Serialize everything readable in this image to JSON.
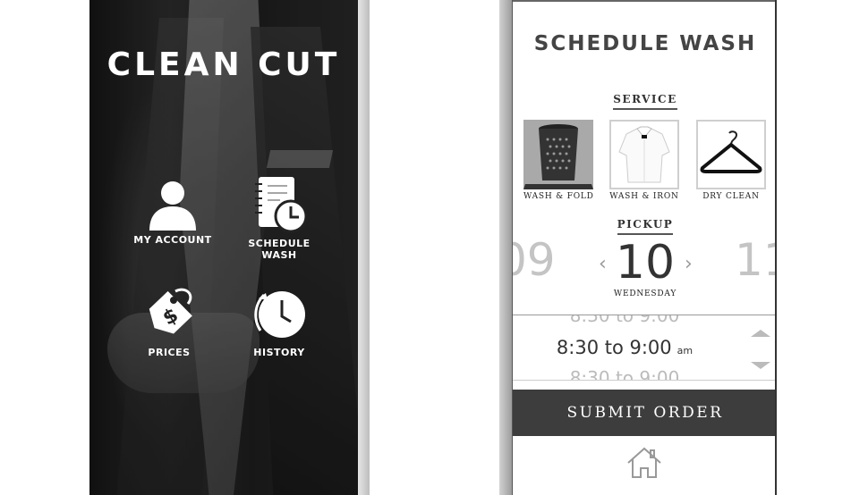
{
  "home": {
    "logo": "CLEAN CUT",
    "menu": {
      "my_account": "MY ACCOUNT",
      "schedule_wash": "SCHEDULE\nWASH",
      "prices": "PRICES",
      "history": "HISTORY"
    }
  },
  "schedule": {
    "title": "SCHEDULE WASH",
    "service_title": "SERVICE",
    "services": [
      {
        "label": "WASH & FOLD",
        "selected": true
      },
      {
        "label": "WASH & IRON",
        "selected": false
      },
      {
        "label": "DRY CLEAN",
        "selected": false
      }
    ],
    "pickup_title": "PICKUP",
    "date_prev": "09",
    "date_current": "10",
    "date_next": "11",
    "weekday": "WEDNESDAY",
    "time_ghost": "8:30 to 9:00",
    "time_current": "8:30 to 9:00",
    "time_ampm": "am",
    "submit_label": "SUBMIT ORDER"
  }
}
